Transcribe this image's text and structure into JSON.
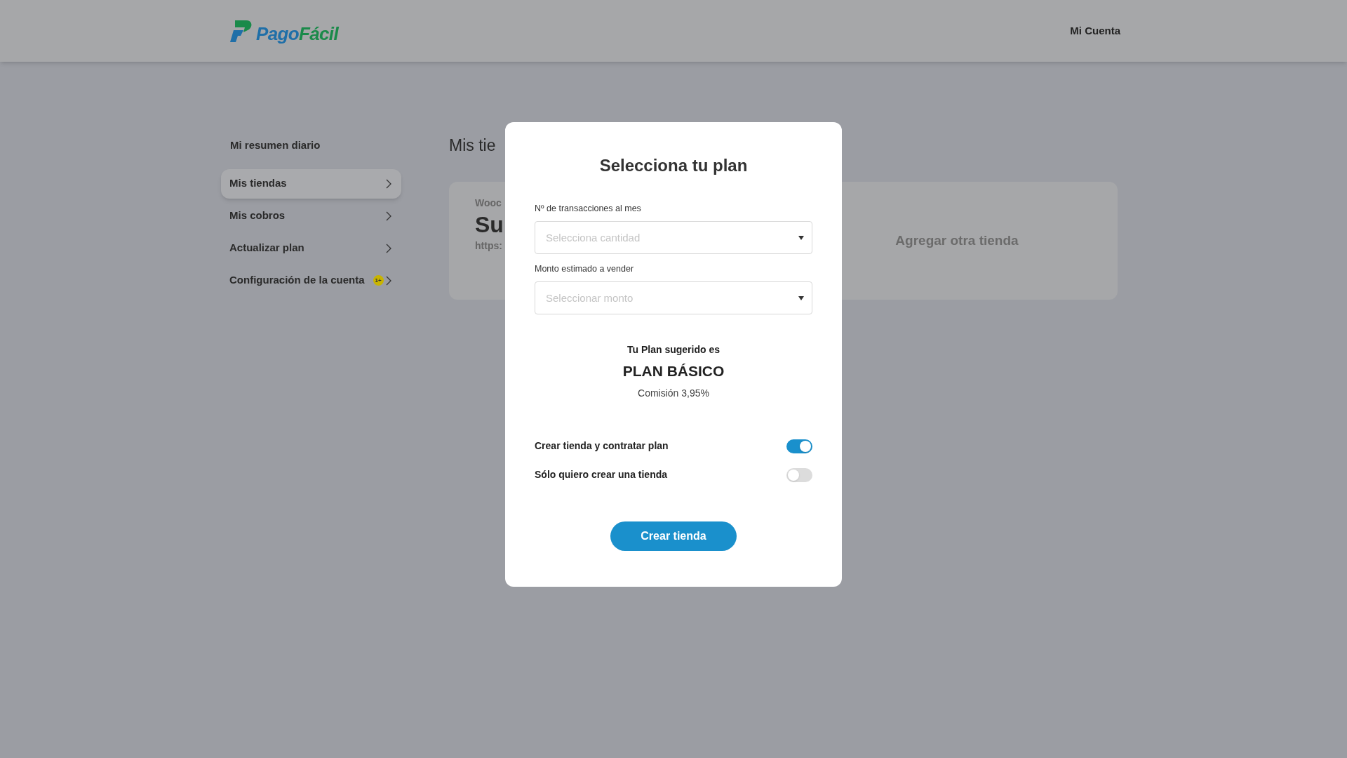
{
  "header": {
    "logo": {
      "part_1": "Pago",
      "part_2": "Fácil"
    },
    "account_link": "Mi Cuenta"
  },
  "sidebar": {
    "title": "Mi resumen diario",
    "items": [
      {
        "label": "Mis tiendas",
        "selected": true
      },
      {
        "label": "Mis cobros",
        "selected": false
      },
      {
        "label": "Actualizar plan",
        "selected": false
      },
      {
        "label": "Configuración de la cuenta",
        "selected": false,
        "badge": "1+"
      }
    ]
  },
  "content": {
    "heading": "Mis tie",
    "store_card": {
      "platform": "Wooc",
      "name": "Su",
      "url": "https:"
    },
    "add_store": "Agregar otra tienda"
  },
  "modal": {
    "title": "Selecciona tu plan",
    "fields": [
      {
        "label": "Nº de transacciones al mes",
        "placeholder": "Selecciona cantidad"
      },
      {
        "label": "Monto estimado a vender",
        "placeholder": "Seleccionar monto"
      }
    ],
    "suggestion": {
      "intro": "Tu Plan sugerido es",
      "plan": "PLAN BÁSICO",
      "commission": "Comisión 3,95%"
    },
    "options": [
      {
        "label": "Crear tienda y contratar plan",
        "on": true
      },
      {
        "label": "Sólo quiero crear una tienda",
        "on": false
      }
    ],
    "button": "Crear tienda"
  }
}
